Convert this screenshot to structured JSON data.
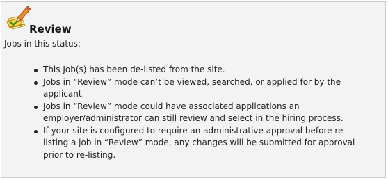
{
  "header": {
    "icon": "review-pencil-icon",
    "title": "Review"
  },
  "intro": "Jobs in this status:",
  "bullets": [
    {
      "line1": "This Job(s) has been de-listed from the site.",
      "line2": ""
    },
    {
      "line1": "Jobs in “Review” mode can’t be viewed, searched, or applied for by the",
      "line2": "applicant."
    },
    {
      "line1": "Jobs in “Review” mode could have associated applications an",
      "line2": "employer/administrator can still review and select in the hiring process."
    },
    {
      "line1": "If your site is configured to require an administrative approval before re-",
      "line2": "listing a job in “Review” mode, any changes will be submitted for approval",
      "line3": "prior to re-listing."
    }
  ]
}
